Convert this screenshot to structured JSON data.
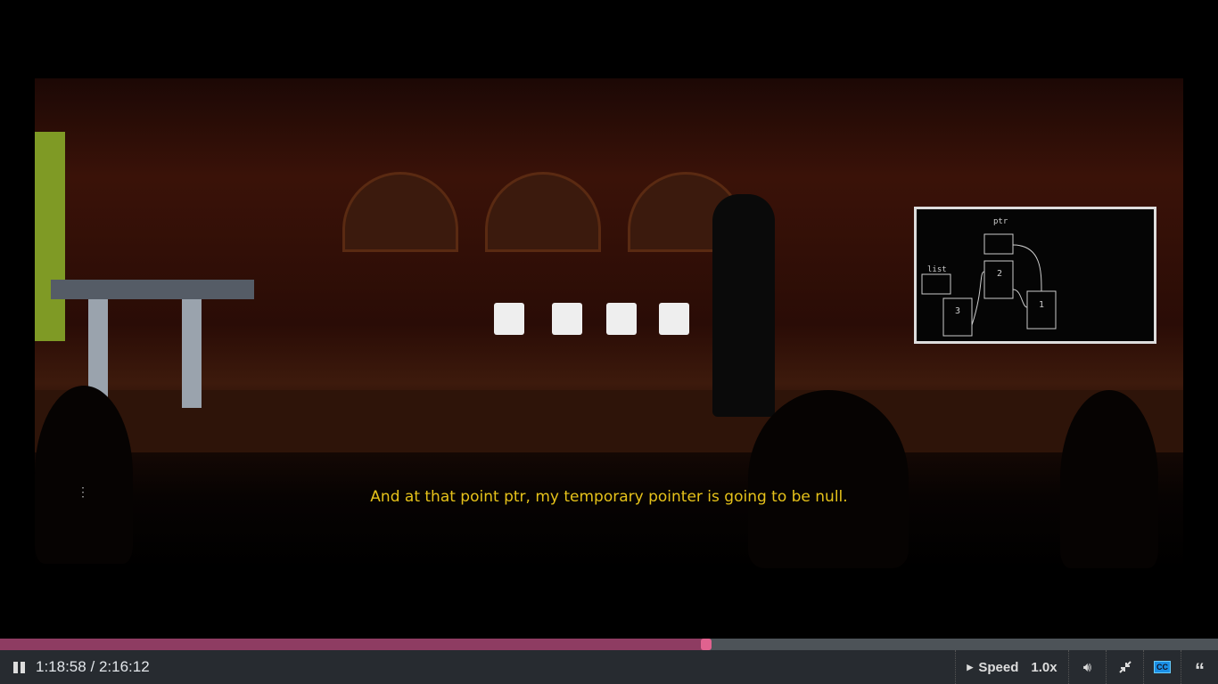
{
  "video": {
    "subtitle": "And at that point ptr, my temporary pointer is going to be null.",
    "whiteboard": {
      "ptr": "ptr",
      "list": "list",
      "n1": "2",
      "n2": "3",
      "n3": "1"
    }
  },
  "player": {
    "current_time": "1:18:58",
    "separator": "/",
    "duration": "2:16:12",
    "progress_percent": 58,
    "speed_label": "Speed",
    "speed_value": "1.0x",
    "cc_label": "CC",
    "colors": {
      "progress": "#8e3c62",
      "handle": "#e0628f",
      "cc": "#1a8fe6",
      "subtitle": "#e6c21a"
    }
  }
}
